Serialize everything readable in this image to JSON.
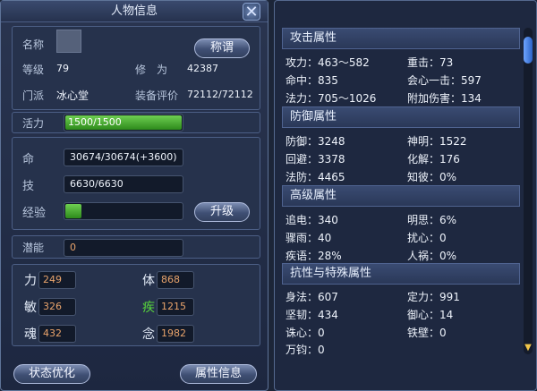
{
  "window": {
    "title": "人物信息",
    "close_icon": "close-icon"
  },
  "profile": {
    "name_label": "名称",
    "nickname_button": "称谓",
    "level_label": "等级",
    "level_value": "79",
    "cultivation_label": "修　为",
    "cultivation_value": "42387",
    "sect_label": "门派",
    "sect_value": "冰心堂",
    "gear_label": "装备评价",
    "gear_value": "72112/72112"
  },
  "resources": {
    "vitality_label": "活力",
    "vitality_value": "1500/1500",
    "vitality_fraction": 1.0,
    "hp_label": "命",
    "hp_value": "30674/30674(+3600)",
    "skill_label": "技",
    "skill_value": "6630/6630",
    "exp_label": "经验",
    "exp_fraction": 0.14,
    "upgrade_button": "升级",
    "potential_label": "潜能",
    "potential_value": "0"
  },
  "attributes": [
    {
      "name": "力",
      "value": "249",
      "color": "#e4ecf8"
    },
    {
      "name": "体",
      "value": "868",
      "color": "#e4ecf8"
    },
    {
      "name": "敏",
      "value": "326",
      "color": "#e4ecf8"
    },
    {
      "name": "疾",
      "value": "1215",
      "color": "#57d23c"
    },
    {
      "name": "魂",
      "value": "432",
      "color": "#e4ecf8"
    },
    {
      "name": "念",
      "value": "1982",
      "color": "#e4ecf8"
    }
  ],
  "footer": {
    "optimize_button": "状态优化",
    "attr_info_button": "属性信息"
  },
  "stats": {
    "attack_header": "攻击属性",
    "attack": [
      "攻力：463～582",
      "重击：73",
      "命中：835",
      "会心一击：597",
      "法力：705～1026",
      "附加伤害：134"
    ],
    "defense_header": "防御属性",
    "defense": [
      "防御：3248",
      "神明：1522",
      "回避：3378",
      "化解：176",
      "法防：4465",
      "知彼：0%"
    ],
    "advanced_header": "高级属性",
    "advanced": [
      "追电：340",
      "明思：6%",
      "骤雨：40",
      "扰心：0",
      "疾语：28%",
      "人祸：0%"
    ],
    "resist_header": "抗性与特殊属性",
    "resist": [
      "身法：607",
      "定力：991",
      "坚韧：434",
      "御心：14",
      "诛心：0",
      "铁壁：0",
      "万钧：0"
    ]
  }
}
